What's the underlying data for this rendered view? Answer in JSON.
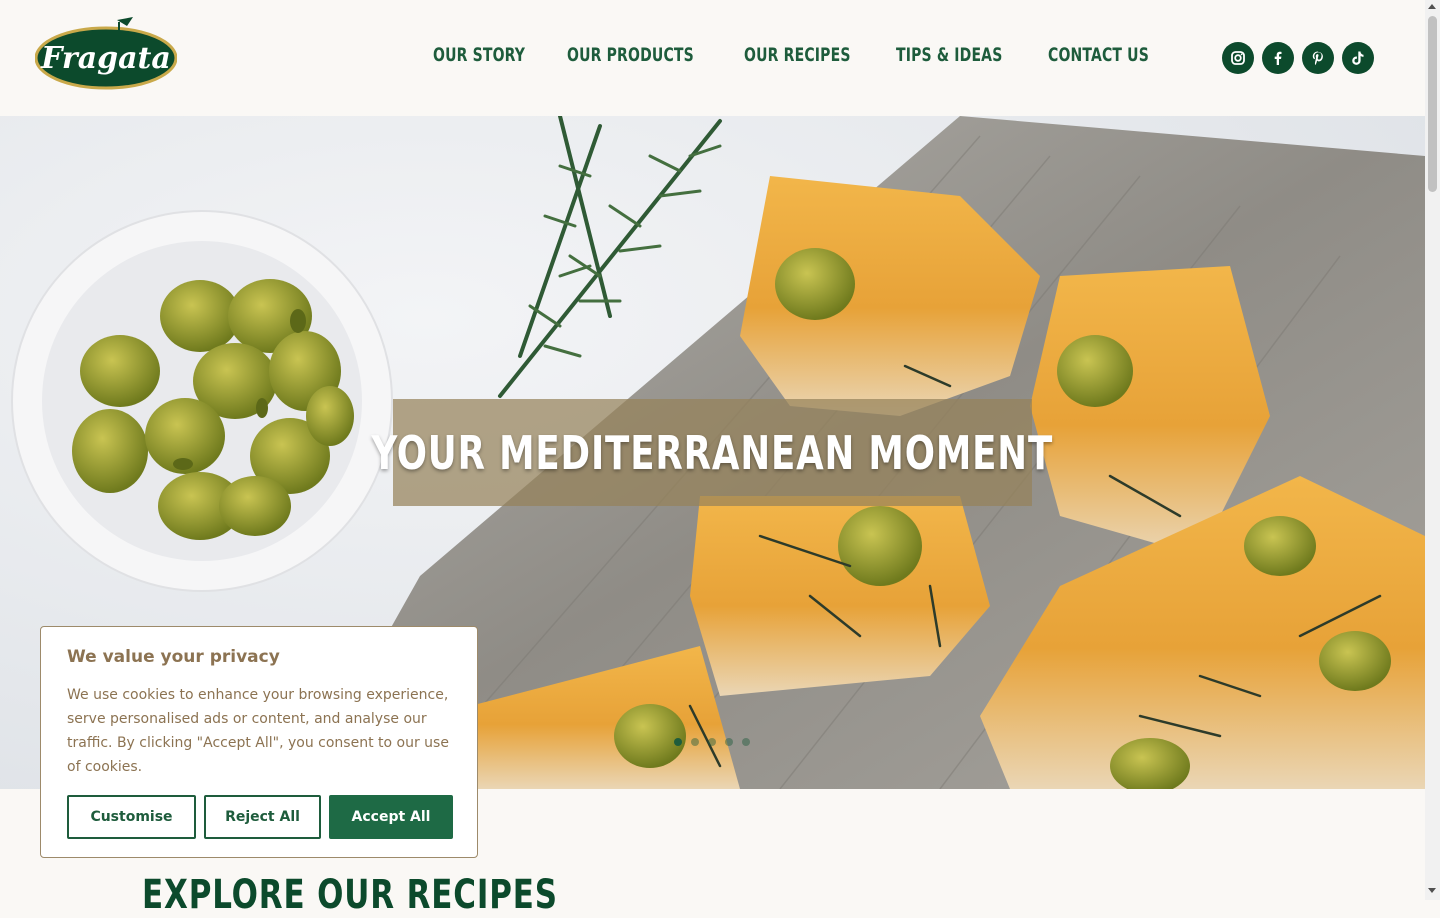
{
  "brand": {
    "name": "Fragata"
  },
  "nav": {
    "items": [
      "OUR STORY",
      "OUR PRODUCTS",
      "OUR RECIPES",
      "TIPS & IDEAS",
      "CONTACT US"
    ]
  },
  "social": [
    {
      "icon": "instagram-icon"
    },
    {
      "icon": "facebook-icon"
    },
    {
      "icon": "pinterest-icon"
    },
    {
      "icon": "tiktok-icon"
    }
  ],
  "hero": {
    "title": "YOUR MEDITERRANEAN MOMENT",
    "slides": 5,
    "active_slide": 1
  },
  "section": {
    "title": "EXPLORE OUR RECIPES"
  },
  "cookie": {
    "title": "We value your privacy",
    "body": "We use cookies to enhance your browsing experience, serve personalised ads or content, and analyse our traffic. By clicking \"Accept All\", you consent to our use of cookies.",
    "customise": "Customise",
    "reject": "Reject All",
    "accept": "Accept All"
  },
  "colors": {
    "brand_green": "#1e5c3c",
    "dark_green": "#0c4a2c",
    "cookie_text": "#8c7352"
  }
}
